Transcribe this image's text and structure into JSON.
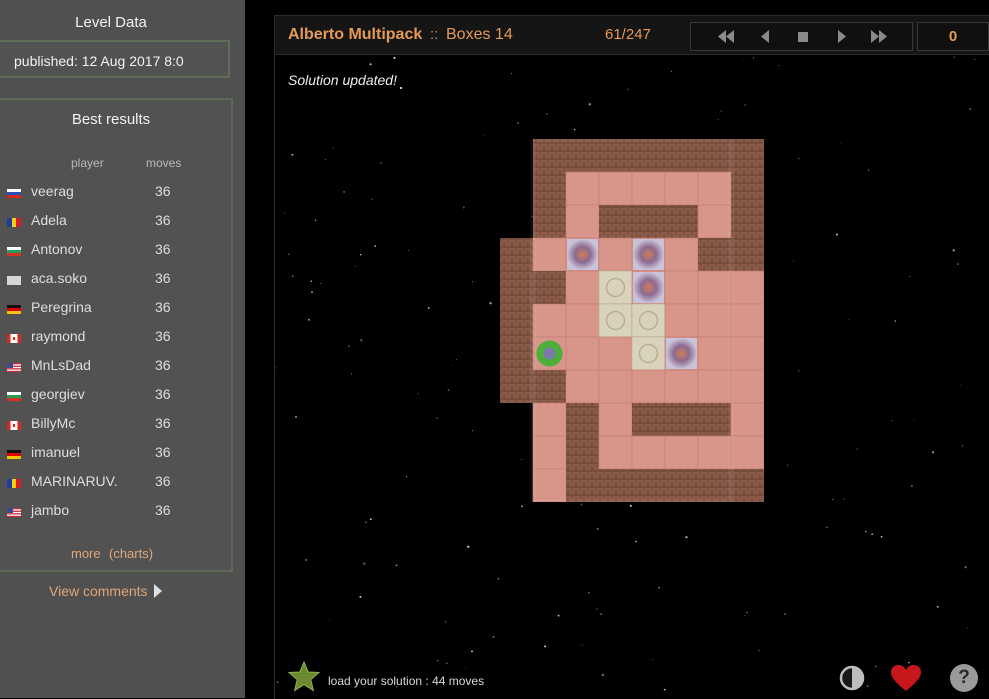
{
  "sidebar": {
    "level_data_title": "Level Data",
    "published": "published: 12 Aug 2017 8:0",
    "best_results_title": "Best results",
    "col_player": "player",
    "col_moves": "moves",
    "results": [
      {
        "player": "veerag",
        "moves": "36",
        "flag": "ru"
      },
      {
        "player": "Adela",
        "moves": "36",
        "flag": "ro"
      },
      {
        "player": "Antonov",
        "moves": "36",
        "flag": "bg"
      },
      {
        "player": "aca.soko",
        "moves": "36",
        "flag": "blank"
      },
      {
        "player": "Peregrina",
        "moves": "36",
        "flag": "de"
      },
      {
        "player": "raymond",
        "moves": "36",
        "flag": "ca"
      },
      {
        "player": "MnLsDad",
        "moves": "36",
        "flag": "us"
      },
      {
        "player": "georgiev",
        "moves": "36",
        "flag": "bg"
      },
      {
        "player": "BillyMc",
        "moves": "36",
        "flag": "ca"
      },
      {
        "player": "imanuel",
        "moves": "36",
        "flag": "de"
      },
      {
        "player": "MARINARUV.",
        "moves": "36",
        "flag": "ro"
      },
      {
        "player": "jambo",
        "moves": "36",
        "flag": "us"
      }
    ],
    "more_label": "more",
    "charts_label": "(charts)",
    "view_comments_label": "View comments"
  },
  "game": {
    "pack_name": "Alberto Multipack",
    "separator": "::",
    "level_name": "Boxes 14",
    "level_index": "61/247",
    "move_count": "0",
    "status_message": "Solution updated!",
    "load_solution_label": "load your solution : 44 moves",
    "nav_icons": [
      "first-level-icon",
      "previous-level-icon",
      "stop-icon",
      "next-level-icon",
      "last-level-icon"
    ],
    "bottom_icons": [
      "star-icon",
      "contrast-icon",
      "heart-icon",
      "help-icon"
    ],
    "help_glyph": "?",
    "board": {
      "rows": [
        "#######",
        "#  :  #",
        "# ### #",
        "# $ $ ####",
        "## .$    #",
        "#  ..    #",
        "#@  .$  ##",
        "##       #",
        " # ### # ",
        " #     # ",
        " ####### "
      ],
      "legend": {
        "#": "wall",
        " ": "floor",
        "$": "box",
        ".": "goal",
        "@": "player"
      }
    },
    "colors": {
      "accent": "#e49a55",
      "floor": "#d8958a",
      "wall": "#8a5a48",
      "goal": "#d9d2bc",
      "player": "#4caf3a"
    }
  }
}
